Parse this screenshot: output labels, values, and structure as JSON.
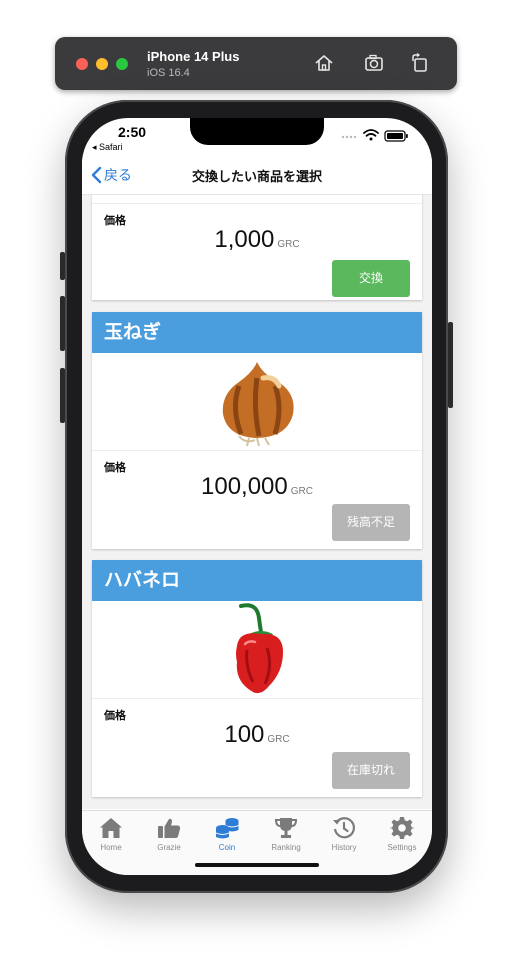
{
  "simulator": {
    "device": "iPhone 14 Plus",
    "os": "iOS 16.4",
    "toolbar_icons": [
      "home-icon",
      "screenshot-icon",
      "rotate-icon"
    ]
  },
  "status_bar": {
    "time": "2:50",
    "back_app": "◂ Safari"
  },
  "navbar": {
    "back_label": "戻る",
    "title": "交換したい商品を選択"
  },
  "products": [
    {
      "name": "",
      "price_label": "価格",
      "price": "1,000",
      "unit": "GRC",
      "button": "交換",
      "button_state": "enabled",
      "button_color": "#5cb85c"
    },
    {
      "name": "玉ねぎ",
      "image": "onion",
      "price_label": "価格",
      "price": "100,000",
      "unit": "GRC",
      "button": "残高不足",
      "button_state": "disabled",
      "button_color": "#b5b5b5"
    },
    {
      "name": "ハバネロ",
      "image": "habanero",
      "price_label": "価格",
      "price": "100",
      "unit": "GRC",
      "button": "在庫切れ",
      "button_state": "disabled",
      "button_color": "#b5b5b5"
    }
  ],
  "tabbar": {
    "active": "Coin",
    "active_color": "#2f7bd6",
    "items": [
      {
        "label": "Home",
        "icon": "home-icon"
      },
      {
        "label": "Grazie",
        "icon": "thumbs-up-icon"
      },
      {
        "label": "Coin",
        "icon": "coins-icon"
      },
      {
        "label": "Ranking",
        "icon": "trophy-icon"
      },
      {
        "label": "History",
        "icon": "history-icon"
      },
      {
        "label": "Settings",
        "icon": "gear-icon"
      }
    ]
  },
  "colors": {
    "header_blue": "#4a9edd",
    "link_blue": "#2f7bd6"
  }
}
